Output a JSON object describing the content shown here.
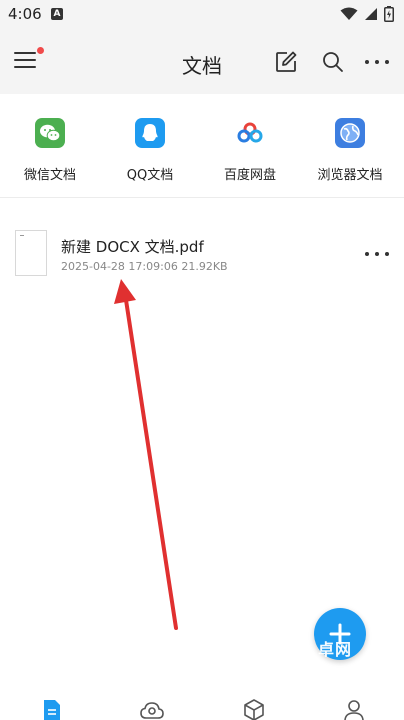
{
  "status_bar": {
    "time": "4:06",
    "notification_letter": "A"
  },
  "app_bar": {
    "title": "文档",
    "has_notification_dot": true
  },
  "sources": [
    {
      "label": "微信文档",
      "icon": "wechat-icon",
      "color": "#4caf50"
    },
    {
      "label": "QQ文档",
      "icon": "qq-icon",
      "color": "#1e9bf0"
    },
    {
      "label": "百度网盘",
      "icon": "baidu-netdisk-icon",
      "color": "#2a7de1"
    },
    {
      "label": "浏览器文档",
      "icon": "browser-icon",
      "color": "#3d7ee0"
    }
  ],
  "files": [
    {
      "name": "新建 DOCX 文档.pdf",
      "meta": "2025-04-28 17:09:06 21.92KB"
    }
  ],
  "fab": {
    "icon": "plus-icon",
    "color": "#1e9bf0",
    "watermark": "卓网"
  },
  "bottom_nav": [
    {
      "icon": "documents-icon",
      "active": true,
      "color": "#1e9bf0"
    },
    {
      "icon": "cloud-icon",
      "active": false
    },
    {
      "icon": "tools-icon",
      "active": false
    },
    {
      "icon": "profile-icon",
      "active": false
    }
  ],
  "colors": {
    "accent": "#1e9bf0",
    "annotation": "#e03030",
    "header_bg": "#f4f4f4"
  }
}
